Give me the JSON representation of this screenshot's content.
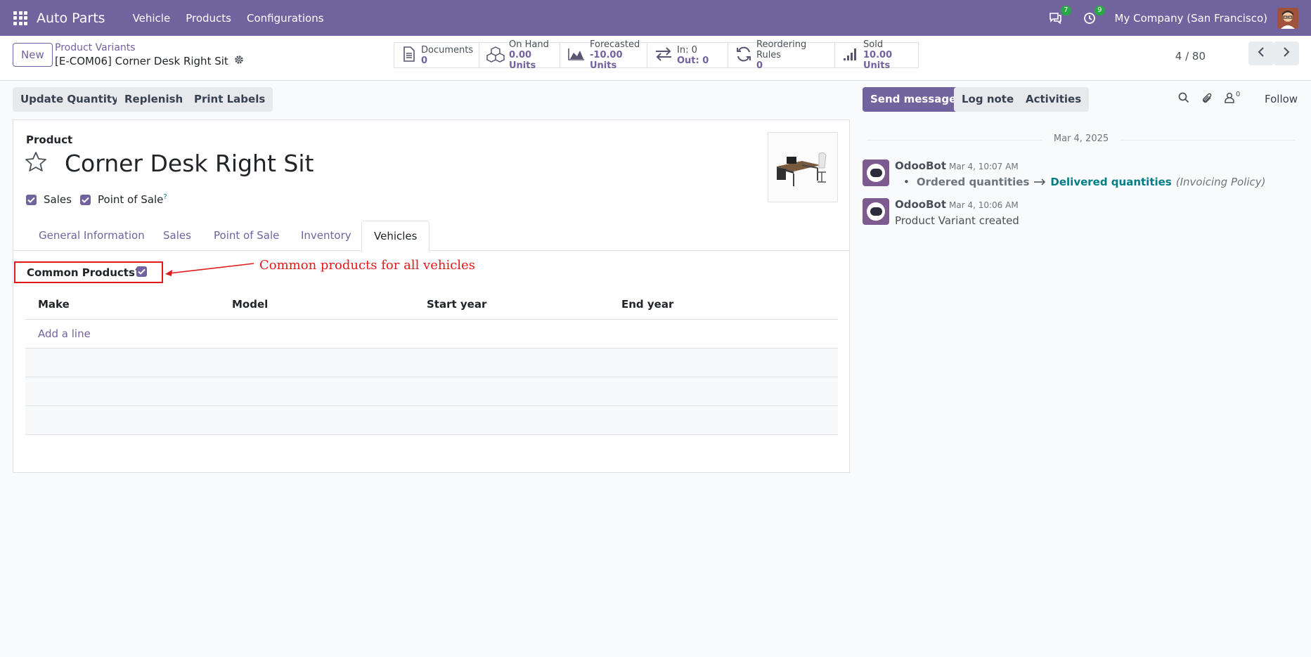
{
  "navbar": {
    "app_name": "Auto Parts",
    "menu": [
      "Vehicle",
      "Products",
      "Configurations"
    ],
    "messages_count": "7",
    "activities_count": "9",
    "company": "My Company (San Francisco)"
  },
  "control_panel": {
    "new_label": "New",
    "breadcrumb_parent": "Product Variants",
    "breadcrumb_current": "[E-COM06] Corner Desk Right Sit",
    "smart_buttons": [
      {
        "label": "Documents",
        "value": "0",
        "icon": "document-icon"
      },
      {
        "label": "On Hand",
        "value": "0.00 Units",
        "icon": "cubes-icon"
      },
      {
        "label": "Forecasted",
        "value": "-10.00 Units",
        "icon": "area-chart-icon"
      },
      {
        "label": "In: 0",
        "value": "Out: 0",
        "icon": "exchange-icon"
      },
      {
        "label": "Reordering Rules",
        "value": "0",
        "icon": "refresh-icon"
      },
      {
        "label": "Sold",
        "value": "10.00 Units",
        "icon": "signal-icon"
      }
    ],
    "pager": "4 / 80"
  },
  "actions": {
    "update_quantity": "Update Quantity",
    "replenish": "Replenish",
    "print_labels": "Print Labels"
  },
  "form": {
    "product_label": "Product",
    "product_name": "Corner Desk Right Sit",
    "sales_label": "Sales",
    "pos_label": "Point of Sale",
    "pos_help": "?",
    "tabs": [
      "General Information",
      "Sales",
      "Point of Sale",
      "Inventory",
      "Vehicles"
    ],
    "active_tab": "Vehicles",
    "common_products_label": "Common Products?",
    "annotation": "Common products for all vehicles",
    "annotation_color": "#e31919",
    "columns": [
      "Make",
      "Model",
      "Start year",
      "End year"
    ],
    "add_line": "Add a line"
  },
  "chatter": {
    "send_message": "Send message",
    "log_note": "Log note",
    "activities": "Activities",
    "followers_count": "0",
    "follow": "Follow",
    "date_separator": "Mar 4, 2025",
    "messages": [
      {
        "author": "OdooBot",
        "date": "Mar 4, 10:07 AM",
        "old_value": "Ordered quantities",
        "new_value": "Delivered quantities",
        "field": "(Invoicing Policy)"
      },
      {
        "author": "OdooBot",
        "date": "Mar 4, 10:06 AM",
        "body": "Product Variant created"
      }
    ]
  },
  "colors": {
    "brand": "#71639e",
    "link": "#017e84",
    "badge": "#28a745"
  }
}
